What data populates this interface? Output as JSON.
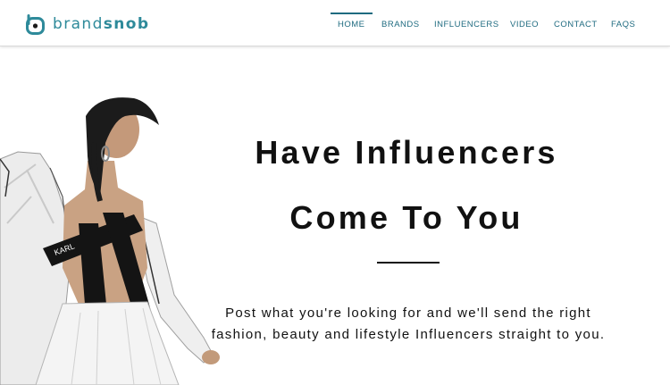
{
  "brand": {
    "name_part1": "brand",
    "name_part2": "snob",
    "accent_color": "#2e8a9a",
    "icon": "brand-b-logo-icon"
  },
  "nav": {
    "items": [
      {
        "label": "HOME",
        "active": true
      },
      {
        "label": "BRANDS",
        "active": false
      },
      {
        "label": "INFLUENCERS",
        "active": false
      },
      {
        "label": "VIDEO",
        "active": false
      },
      {
        "label": "CONTACT",
        "active": false
      },
      {
        "label": "FAQS",
        "active": false
      }
    ],
    "color": "#1f6b80"
  },
  "hero": {
    "headline_line1": "Have Influencers",
    "headline_line2": "Come To You",
    "subtext": "Post what you're looking for and we'll send the right fashion, beauty and lifestyle Influencers straight to you.",
    "image": "fashion-model-photo",
    "strap_text": "KARL"
  }
}
